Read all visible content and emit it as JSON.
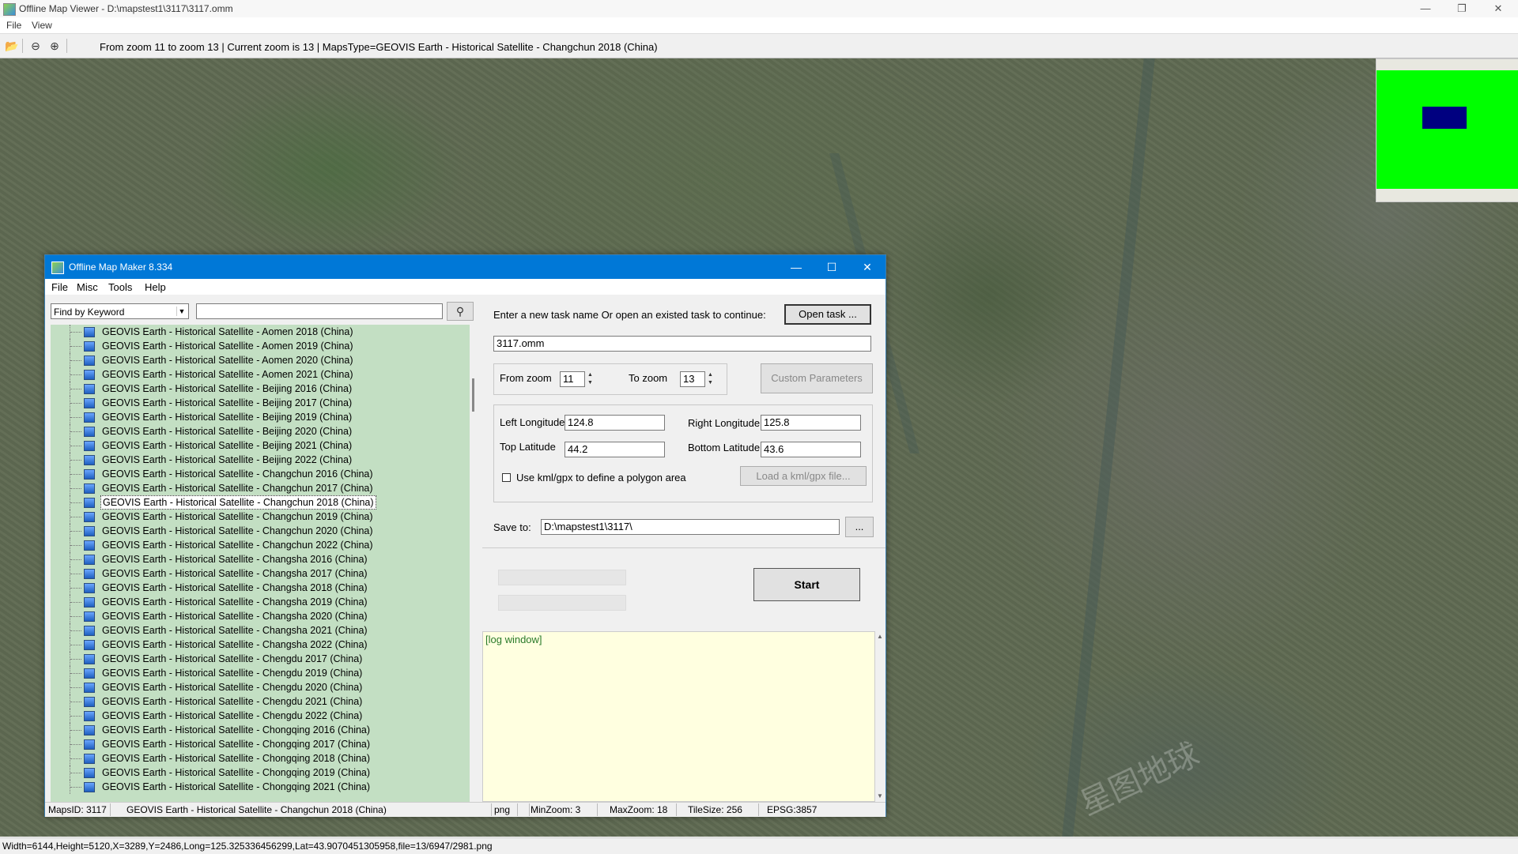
{
  "outer_window": {
    "title": "Offline Map Viewer - D:\\mapstest1\\3117\\3117.omm",
    "menu": [
      "File",
      "View"
    ],
    "toolbar_status": "From zoom 11 to zoom 13   |   Current zoom is 13  |   MapsType=GEOVIS Earth - Historical Satellite - Changchun 2018 (China)",
    "bottom_status": "Width=6144,Height=5120,X=3289,Y=2486,Long=125.325336456299,Lat=43.9070451305958,file=13/6947/2981.png",
    "minimize": "—",
    "restore": "❐",
    "close": "✕"
  },
  "map": {
    "watermark": "星图地球"
  },
  "dialog": {
    "title": "Offline Map Maker 8.334",
    "minimize": "—",
    "maximize": "☐",
    "close": "✕",
    "menu": [
      "File",
      "Misc",
      "Tools",
      "Help"
    ],
    "search": {
      "mode": "Find by Keyword",
      "value": ""
    },
    "tree": [
      "GEOVIS Earth - Historical Satellite - Aomen 2018 (China)",
      "GEOVIS Earth - Historical Satellite - Aomen 2019 (China)",
      "GEOVIS Earth - Historical Satellite - Aomen 2020 (China)",
      "GEOVIS Earth - Historical Satellite - Aomen 2021 (China)",
      "GEOVIS Earth - Historical Satellite - Beijing 2016 (China)",
      "GEOVIS Earth - Historical Satellite - Beijing 2017 (China)",
      "GEOVIS Earth - Historical Satellite - Beijing 2019 (China)",
      "GEOVIS Earth - Historical Satellite - Beijing 2020 (China)",
      "GEOVIS Earth - Historical Satellite - Beijing 2021 (China)",
      "GEOVIS Earth - Historical Satellite - Beijing 2022 (China)",
      "GEOVIS Earth - Historical Satellite - Changchun 2016 (China)",
      "GEOVIS Earth - Historical Satellite - Changchun 2017 (China)",
      "GEOVIS Earth - Historical Satellite - Changchun 2018 (China)",
      "GEOVIS Earth - Historical Satellite - Changchun 2019 (China)",
      "GEOVIS Earth - Historical Satellite - Changchun 2020 (China)",
      "GEOVIS Earth - Historical Satellite - Changchun 2022 (China)",
      "GEOVIS Earth - Historical Satellite - Changsha 2016 (China)",
      "GEOVIS Earth - Historical Satellite - Changsha 2017 (China)",
      "GEOVIS Earth - Historical Satellite - Changsha 2018 (China)",
      "GEOVIS Earth - Historical Satellite - Changsha 2019 (China)",
      "GEOVIS Earth - Historical Satellite - Changsha 2020 (China)",
      "GEOVIS Earth - Historical Satellite - Changsha 2021 (China)",
      "GEOVIS Earth - Historical Satellite - Changsha 2022 (China)",
      "GEOVIS Earth - Historical Satellite - Chengdu 2017 (China)",
      "GEOVIS Earth - Historical Satellite - Chengdu 2019 (China)",
      "GEOVIS Earth - Historical Satellite - Chengdu 2020 (China)",
      "GEOVIS Earth - Historical Satellite - Chengdu 2021 (China)",
      "GEOVIS Earth - Historical Satellite - Chengdu 2022 (China)",
      "GEOVIS Earth - Historical Satellite - Chongqing 2016 (China)",
      "GEOVIS Earth - Historical Satellite - Chongqing 2017 (China)",
      "GEOVIS Earth - Historical Satellite - Chongqing 2018 (China)",
      "GEOVIS Earth - Historical Satellite - Chongqing 2019 (China)",
      "GEOVIS Earth - Historical Satellite - Chongqing 2021 (China)"
    ],
    "selected_tree_index": 12,
    "task_prompt": "Enter a new task name Or open an existed task to continue:",
    "open_task_label": "Open task ...",
    "task_name": "3117.omm",
    "from_zoom_label": "From zoom",
    "from_zoom": "11",
    "to_zoom_label": "To zoom",
    "to_zoom": "13",
    "custom_params_label": "Custom Parameters",
    "left_lon_label": "Left Longitude",
    "left_lon": "124.8",
    "right_lon_label": "Right Longitude",
    "right_lon": "125.8",
    "top_lat_label": "Top Latitude",
    "top_lat": "44.2",
    "bottom_lat_label": "Bottom Latitude",
    "bottom_lat": "43.6",
    "kml_label": "Use kml/gpx to define a polygon area",
    "kml_checked": false,
    "load_kml_label": "Load a kml/gpx file...",
    "save_to_label": "Save to:",
    "save_to": "D:\\mapstest1\\3117\\",
    "browse_label": "...",
    "start_label": "Start",
    "log_label": "[log window]",
    "status": {
      "maps_id": "MapsID: 3117",
      "maps_name": "GEOVIS Earth - Historical Satellite - Changchun 2018 (China)",
      "format": "png",
      "min_zoom": "MinZoom: 3",
      "max_zoom": "MaxZoom: 18",
      "tile_size": "TileSize: 256",
      "epsg": "EPSG:3857"
    }
  }
}
